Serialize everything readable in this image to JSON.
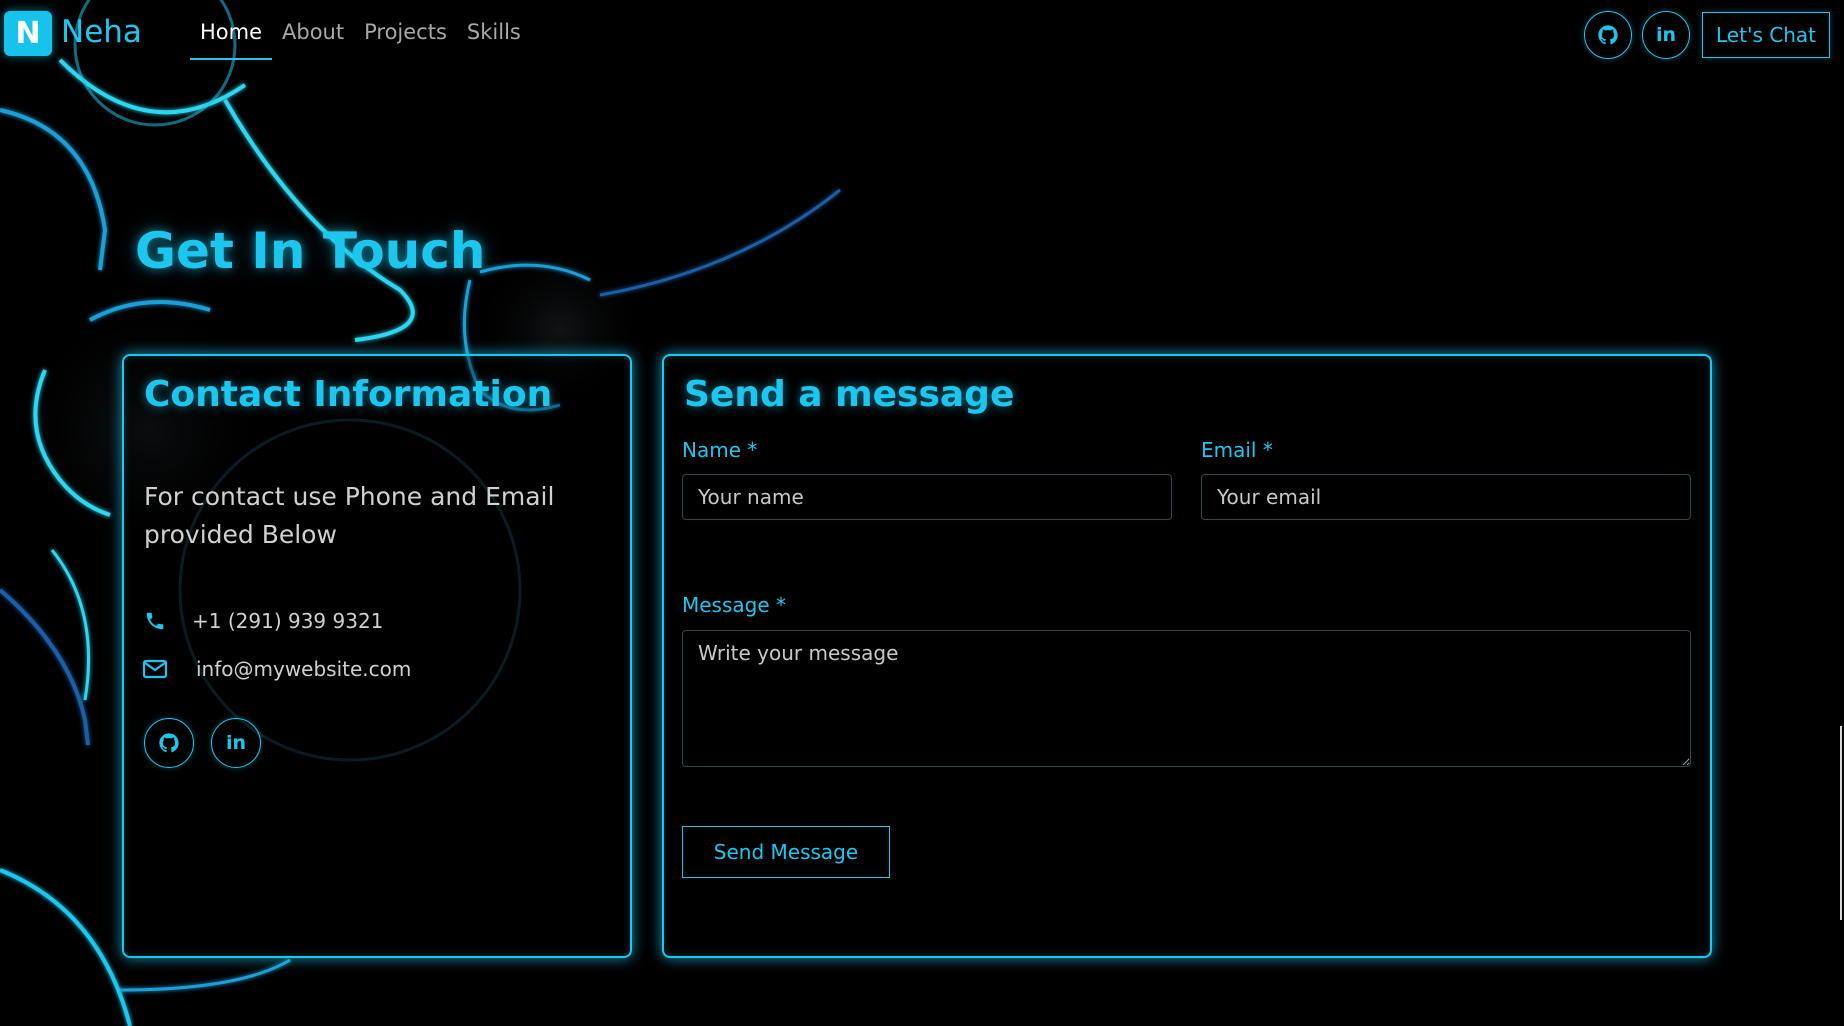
{
  "navbar": {
    "logo_letter": "N",
    "logo_name": "Neha",
    "links": [
      {
        "label": "Home"
      },
      {
        "label": "About"
      },
      {
        "label": "Projects"
      },
      {
        "label": "Skills"
      }
    ],
    "icons": [
      "github-icon",
      "linkedin-icon"
    ],
    "linkedin_text": "in",
    "chat_label": "Let's Chat"
  },
  "page": {
    "heading": "Get In Touch"
  },
  "contact": {
    "title": "Contact Information",
    "description": "For contact use Phone and Email provided Below",
    "phone": "+1 (291) 939 9321",
    "email": "info@mywebsite.com",
    "linkedin_text": "in",
    "icons": [
      "phone-icon",
      "mail-icon",
      "github-icon",
      "linkedin-icon"
    ]
  },
  "form": {
    "title": "Send a message",
    "name_label": "Name *",
    "name_placeholder": "Your name",
    "email_label": "Email *",
    "email_placeholder": "Your email",
    "message_label": "Message *",
    "message_placeholder": "Write your message",
    "submit_label": "Send Message"
  },
  "colors": {
    "accent": "#1cc7ef",
    "background": "#000000",
    "text": "#d0d0d0"
  }
}
